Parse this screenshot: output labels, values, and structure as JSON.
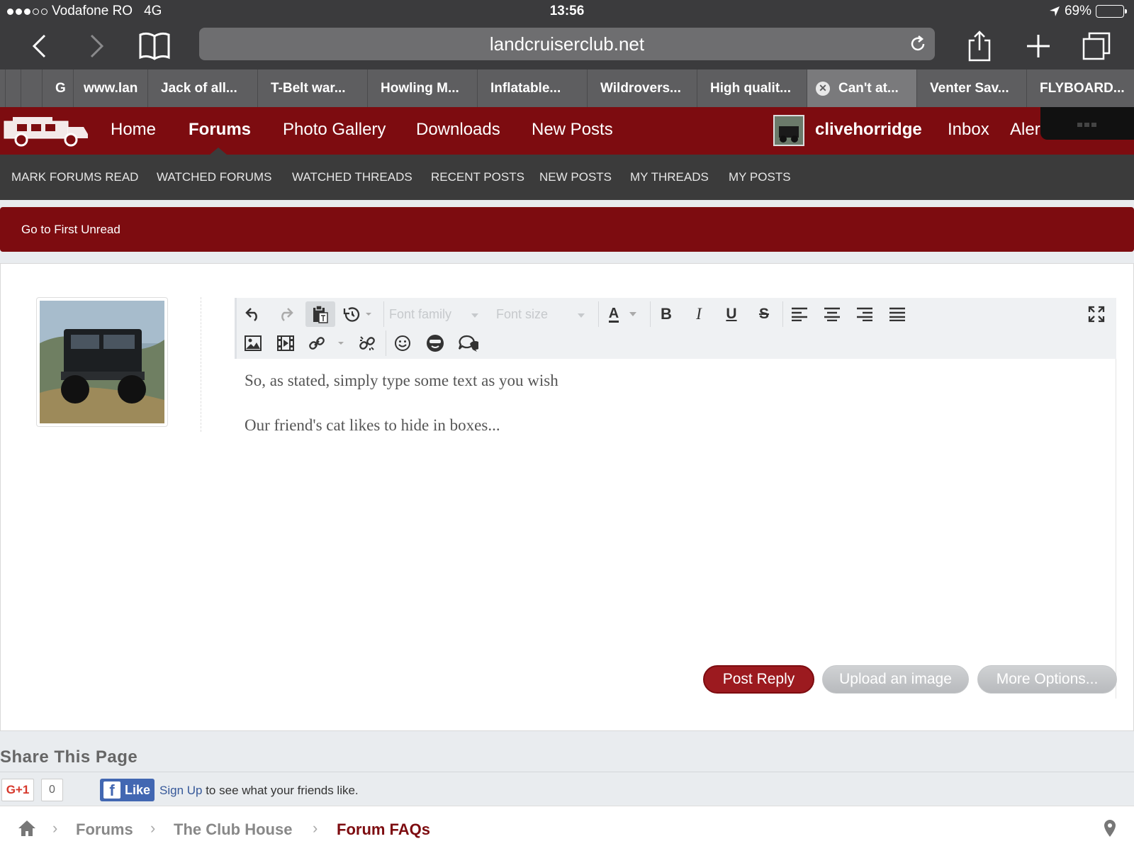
{
  "status": {
    "carrier": "Vodafone RO",
    "network": "4G",
    "time": "13:56",
    "battery": "69%",
    "battery_level": 0.69
  },
  "browser": {
    "url": "landcruiserclub.net",
    "tabs": [
      {
        "label": "G"
      },
      {
        "label": "www.lan"
      },
      {
        "label": "Jack of all..."
      },
      {
        "label": "T-Belt war..."
      },
      {
        "label": "Howling M..."
      },
      {
        "label": "Inflatable..."
      },
      {
        "label": "Wildrovers..."
      },
      {
        "label": "High qualit..."
      },
      {
        "label": "Can't at..."
      },
      {
        "label": "Venter Sav..."
      },
      {
        "label": "FLYBOARD..."
      }
    ]
  },
  "nav": {
    "items": [
      "Home",
      "Forums",
      "Photo Gallery",
      "Downloads",
      "New Posts"
    ],
    "username": "clivehorridge",
    "inbox": "Inbox",
    "alerts": "Aler"
  },
  "subnav": [
    "MARK FORUMS READ",
    "WATCHED FORUMS",
    "WATCHED THREADS",
    "RECENT POSTS",
    "NEW POSTS",
    "MY THREADS",
    "MY POSTS"
  ],
  "unread_link": "Go to First Unread",
  "editor": {
    "font_family_placeholder": "Font family",
    "font_size_placeholder": "Font size",
    "text_color_letter": "A",
    "body": [
      "So, as stated, simply type some text as you wish",
      "Our friend's cat likes to hide in boxes..."
    ]
  },
  "buttons": {
    "post_reply": "Post Reply",
    "upload_image": "Upload an image",
    "more_options": "More Options..."
  },
  "share": {
    "title": "Share This Page",
    "gplus_label": "G+1",
    "gplus_count": "0",
    "fb_like": "Like",
    "fb_signup": "Sign Up",
    "fb_rest": " to see what your friends like."
  },
  "breadcrumb": [
    "Forums",
    "The Club House",
    "Forum FAQs"
  ]
}
